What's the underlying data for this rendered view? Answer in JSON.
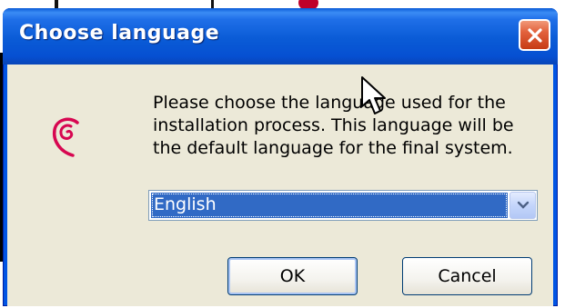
{
  "dialog": {
    "title": "Choose language",
    "message": "Please choose the language used for the\ninstallation process. This language will be\nthe default language for the final system.",
    "language_select": {
      "selected": "English"
    },
    "buttons": {
      "ok": "OK",
      "cancel": "Cancel"
    }
  },
  "icons": {
    "logo": "debian-swirl-icon",
    "close": "close-icon",
    "dropdown": "chevron-down-icon",
    "cursor": "mouse-pointer-icon"
  },
  "colors": {
    "titlebar": "#0a5bd6",
    "client_bg": "#ece9d8",
    "selection": "#316ac5",
    "close_button": "#e2613c",
    "logo": "#d70751"
  }
}
